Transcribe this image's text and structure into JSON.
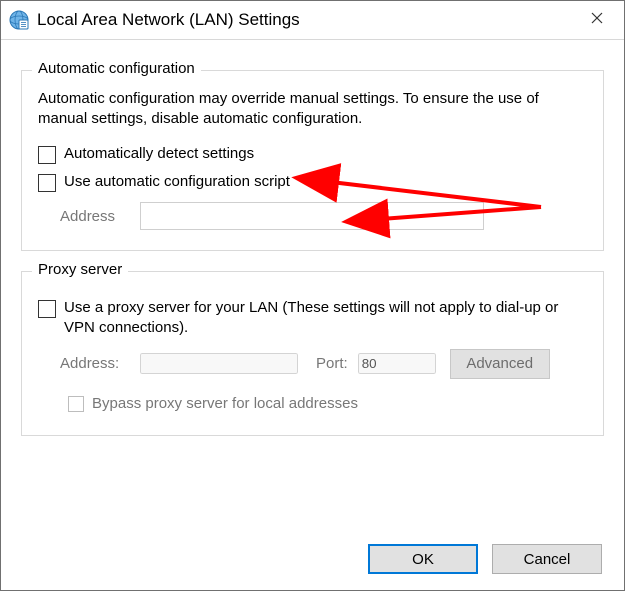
{
  "window": {
    "title": "Local Area Network (LAN) Settings"
  },
  "group_auto": {
    "legend": "Automatic configuration",
    "description": "Automatic configuration may override manual settings.  To ensure the use of manual settings, disable automatic configuration.",
    "auto_detect_label": "Automatically detect settings",
    "auto_script_label": "Use automatic configuration script",
    "address_label": "Address",
    "address_value": ""
  },
  "group_proxy": {
    "legend": "Proxy server",
    "use_proxy_label": "Use a proxy server for your LAN (These settings will not apply to dial-up or VPN connections).",
    "address_label": "Address:",
    "address_value": "",
    "port_label": "Port:",
    "port_value": "80",
    "advanced_label": "Advanced",
    "bypass_label": "Bypass proxy server for local addresses"
  },
  "buttons": {
    "ok": "OK",
    "cancel": "Cancel"
  },
  "annotation": {
    "color": "#ff0000"
  }
}
